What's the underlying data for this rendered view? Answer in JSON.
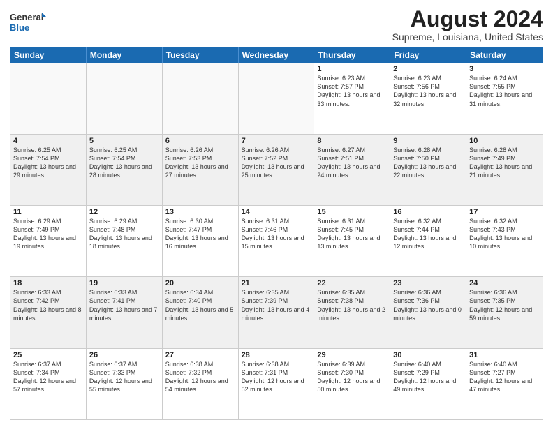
{
  "logo": {
    "line1": "General",
    "line2": "Blue"
  },
  "title": "August 2024",
  "location": "Supreme, Louisiana, United States",
  "days": [
    "Sunday",
    "Monday",
    "Tuesday",
    "Wednesday",
    "Thursday",
    "Friday",
    "Saturday"
  ],
  "weeks": [
    [
      {
        "day": "",
        "content": ""
      },
      {
        "day": "",
        "content": ""
      },
      {
        "day": "",
        "content": ""
      },
      {
        "day": "",
        "content": ""
      },
      {
        "day": "1",
        "content": "Sunrise: 6:23 AM\nSunset: 7:57 PM\nDaylight: 13 hours\nand 33 minutes."
      },
      {
        "day": "2",
        "content": "Sunrise: 6:23 AM\nSunset: 7:56 PM\nDaylight: 13 hours\nand 32 minutes."
      },
      {
        "day": "3",
        "content": "Sunrise: 6:24 AM\nSunset: 7:55 PM\nDaylight: 13 hours\nand 31 minutes."
      }
    ],
    [
      {
        "day": "4",
        "content": "Sunrise: 6:25 AM\nSunset: 7:54 PM\nDaylight: 13 hours\nand 29 minutes."
      },
      {
        "day": "5",
        "content": "Sunrise: 6:25 AM\nSunset: 7:54 PM\nDaylight: 13 hours\nand 28 minutes."
      },
      {
        "day": "6",
        "content": "Sunrise: 6:26 AM\nSunset: 7:53 PM\nDaylight: 13 hours\nand 27 minutes."
      },
      {
        "day": "7",
        "content": "Sunrise: 6:26 AM\nSunset: 7:52 PM\nDaylight: 13 hours\nand 25 minutes."
      },
      {
        "day": "8",
        "content": "Sunrise: 6:27 AM\nSunset: 7:51 PM\nDaylight: 13 hours\nand 24 minutes."
      },
      {
        "day": "9",
        "content": "Sunrise: 6:28 AM\nSunset: 7:50 PM\nDaylight: 13 hours\nand 22 minutes."
      },
      {
        "day": "10",
        "content": "Sunrise: 6:28 AM\nSunset: 7:49 PM\nDaylight: 13 hours\nand 21 minutes."
      }
    ],
    [
      {
        "day": "11",
        "content": "Sunrise: 6:29 AM\nSunset: 7:49 PM\nDaylight: 13 hours\nand 19 minutes."
      },
      {
        "day": "12",
        "content": "Sunrise: 6:29 AM\nSunset: 7:48 PM\nDaylight: 13 hours\nand 18 minutes."
      },
      {
        "day": "13",
        "content": "Sunrise: 6:30 AM\nSunset: 7:47 PM\nDaylight: 13 hours\nand 16 minutes."
      },
      {
        "day": "14",
        "content": "Sunrise: 6:31 AM\nSunset: 7:46 PM\nDaylight: 13 hours\nand 15 minutes."
      },
      {
        "day": "15",
        "content": "Sunrise: 6:31 AM\nSunset: 7:45 PM\nDaylight: 13 hours\nand 13 minutes."
      },
      {
        "day": "16",
        "content": "Sunrise: 6:32 AM\nSunset: 7:44 PM\nDaylight: 13 hours\nand 12 minutes."
      },
      {
        "day": "17",
        "content": "Sunrise: 6:32 AM\nSunset: 7:43 PM\nDaylight: 13 hours\nand 10 minutes."
      }
    ],
    [
      {
        "day": "18",
        "content": "Sunrise: 6:33 AM\nSunset: 7:42 PM\nDaylight: 13 hours\nand 8 minutes."
      },
      {
        "day": "19",
        "content": "Sunrise: 6:33 AM\nSunset: 7:41 PM\nDaylight: 13 hours\nand 7 minutes."
      },
      {
        "day": "20",
        "content": "Sunrise: 6:34 AM\nSunset: 7:40 PM\nDaylight: 13 hours\nand 5 minutes."
      },
      {
        "day": "21",
        "content": "Sunrise: 6:35 AM\nSunset: 7:39 PM\nDaylight: 13 hours\nand 4 minutes."
      },
      {
        "day": "22",
        "content": "Sunrise: 6:35 AM\nSunset: 7:38 PM\nDaylight: 13 hours\nand 2 minutes."
      },
      {
        "day": "23",
        "content": "Sunrise: 6:36 AM\nSunset: 7:36 PM\nDaylight: 13 hours\nand 0 minutes."
      },
      {
        "day": "24",
        "content": "Sunrise: 6:36 AM\nSunset: 7:35 PM\nDaylight: 12 hours\nand 59 minutes."
      }
    ],
    [
      {
        "day": "25",
        "content": "Sunrise: 6:37 AM\nSunset: 7:34 PM\nDaylight: 12 hours\nand 57 minutes."
      },
      {
        "day": "26",
        "content": "Sunrise: 6:37 AM\nSunset: 7:33 PM\nDaylight: 12 hours\nand 55 minutes."
      },
      {
        "day": "27",
        "content": "Sunrise: 6:38 AM\nSunset: 7:32 PM\nDaylight: 12 hours\nand 54 minutes."
      },
      {
        "day": "28",
        "content": "Sunrise: 6:38 AM\nSunset: 7:31 PM\nDaylight: 12 hours\nand 52 minutes."
      },
      {
        "day": "29",
        "content": "Sunrise: 6:39 AM\nSunset: 7:30 PM\nDaylight: 12 hours\nand 50 minutes."
      },
      {
        "day": "30",
        "content": "Sunrise: 6:40 AM\nSunset: 7:29 PM\nDaylight: 12 hours\nand 49 minutes."
      },
      {
        "day": "31",
        "content": "Sunrise: 6:40 AM\nSunset: 7:27 PM\nDaylight: 12 hours\nand 47 minutes."
      }
    ]
  ]
}
